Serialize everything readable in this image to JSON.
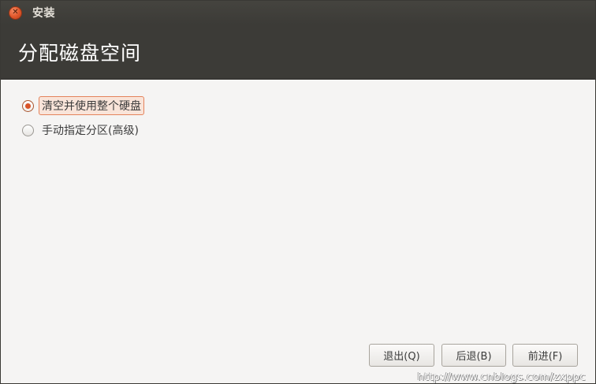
{
  "window": {
    "title": "安装",
    "close_icon": "close-icon"
  },
  "header": {
    "title": "分配磁盘空间"
  },
  "options": [
    {
      "label": "清空并使用整个硬盘",
      "selected": true
    },
    {
      "label": "手动指定分区(高级)",
      "selected": false
    }
  ],
  "buttons": {
    "quit": "退出(Q)",
    "back": "后退(B)",
    "forward": "前进(F)"
  },
  "watermark": "http://www.cnblogs.com/zxppc",
  "colors": {
    "header_bg": "#3c3b37",
    "accent": "#d9542a",
    "content_bg": "#f5f4f3"
  }
}
